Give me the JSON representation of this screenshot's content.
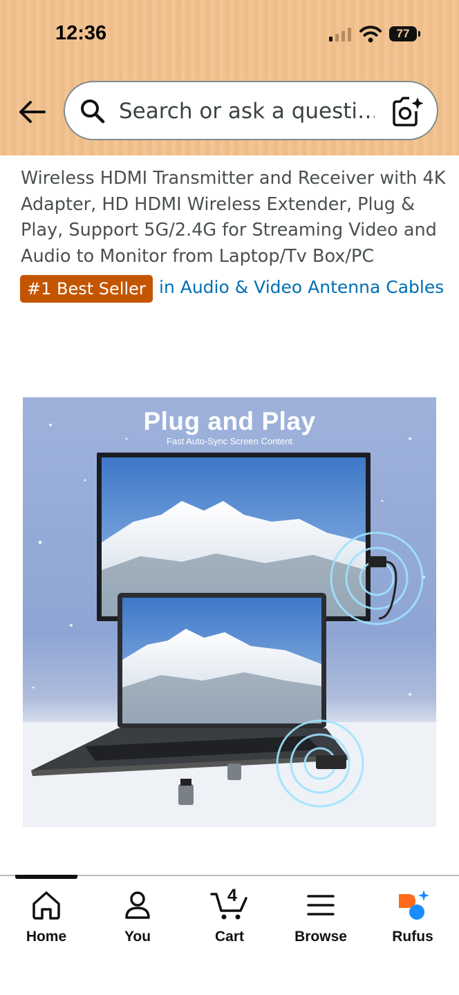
{
  "status_bar": {
    "time": "12:36",
    "battery": "77"
  },
  "header": {
    "search_placeholder": "Search or ask a questi…"
  },
  "product": {
    "title": "Wireless HDMI Transmitter and Receiver with 4K Adapter, HD HDMI Wireless Extender, Plug & Play, Support 5G/2.4G for Streaming Video and Audio to Monitor from Laptop/Tv Box/PC",
    "badge": "#1 Best Seller",
    "category_link": "in Audio & Video Antenna Cables",
    "image_heading": "Plug and Play",
    "image_subheading": "Fast Auto-Sync Screen Content"
  },
  "bottom_nav": {
    "items": [
      {
        "label": "Home",
        "icon": "home-icon"
      },
      {
        "label": "You",
        "icon": "user-icon"
      },
      {
        "label": "Cart",
        "icon": "cart-icon",
        "count": "4"
      },
      {
        "label": "Browse",
        "icon": "menu-icon"
      },
      {
        "label": "Rufus",
        "icon": "rufus-icon"
      }
    ]
  },
  "colors": {
    "header_bg": "#f2c493",
    "badge_bg": "#c45500",
    "link": "#006fb2",
    "rufus_orange": "#ff6b1a",
    "rufus_blue": "#1a8cff"
  }
}
